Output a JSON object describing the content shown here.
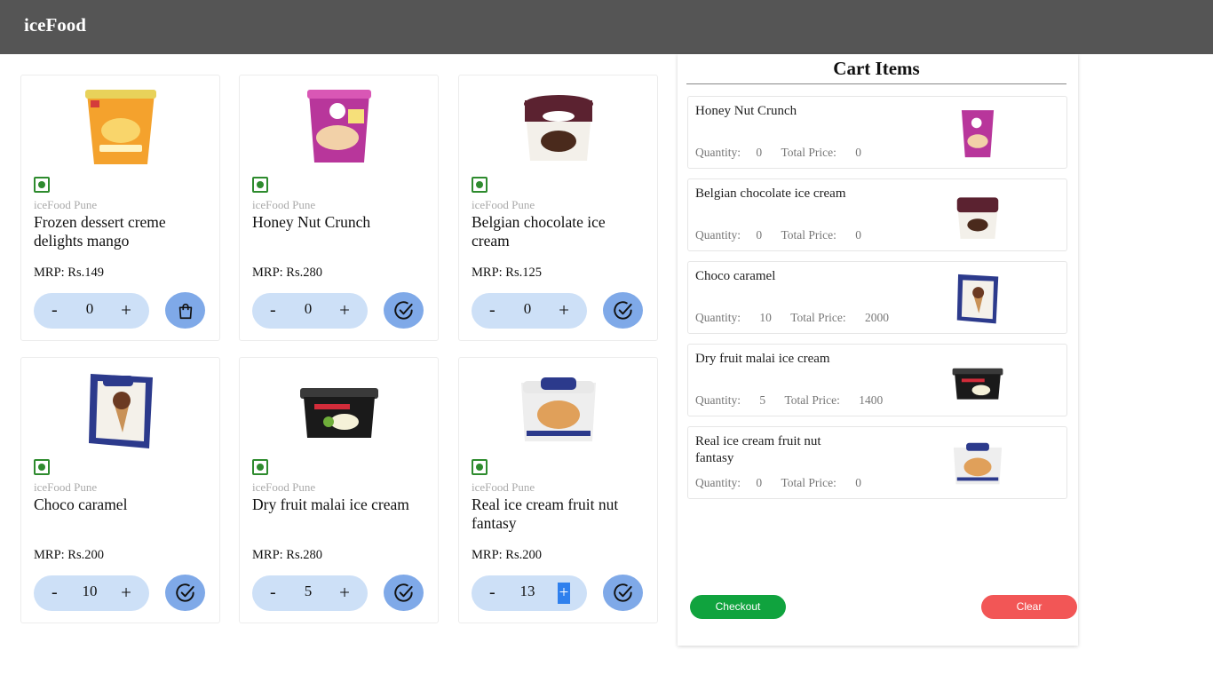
{
  "app": {
    "brand": "iceFood"
  },
  "products": [
    {
      "store": "iceFood Pune",
      "name": "Frozen dessert creme delights mango",
      "mrp": "MRP: Rs.149",
      "qty": "0",
      "action_icon": "bag-icon",
      "in_cart": false
    },
    {
      "store": "iceFood Pune",
      "name": "Honey Nut Crunch",
      "mrp": "MRP: Rs.280",
      "qty": "0",
      "action_icon": "check-circle-icon",
      "in_cart": true
    },
    {
      "store": "iceFood Pune",
      "name": "Belgian chocolate ice cream",
      "mrp": "MRP: Rs.125",
      "qty": "0",
      "action_icon": "check-circle-icon",
      "in_cart": true
    },
    {
      "store": "iceFood Pune",
      "name": "Choco caramel",
      "mrp": "MRP: Rs.200",
      "qty": "10",
      "action_icon": "check-circle-icon",
      "in_cart": true
    },
    {
      "store": "iceFood Pune",
      "name": "Dry fruit malai ice cream",
      "mrp": "MRP: Rs.280",
      "qty": "5",
      "action_icon": "check-circle-icon",
      "in_cart": true
    },
    {
      "store": "iceFood Pune",
      "name": "Real ice cream fruit nut fantasy",
      "mrp": "MRP: Rs.200",
      "qty": "13",
      "action_icon": "check-circle-icon",
      "in_cart": true
    }
  ],
  "stepper": {
    "minus": "-",
    "plus": "+"
  },
  "cart": {
    "title": "Cart Items",
    "quantity_label": "Quantity:",
    "total_label": "Total Price:",
    "items": [
      {
        "name": "Honey Nut Crunch",
        "quantity": "0",
        "total": "0"
      },
      {
        "name": "Belgian chocolate ice cream",
        "quantity": "0",
        "total": "0"
      },
      {
        "name": "Choco caramel",
        "quantity": "10",
        "total": "2000"
      },
      {
        "name": "Dry fruit malai ice cream",
        "quantity": "5",
        "total": "1400"
      },
      {
        "name": "Real ice cream fruit nut fantasy",
        "quantity": "0",
        "total": "0"
      }
    ],
    "checkout_label": "Checkout",
    "clear_label": "Clear"
  },
  "colors": {
    "navbar": "#555555",
    "stepper_bg": "#cde0f7",
    "action_button": "#7fa9e8",
    "checkout": "#10a33e",
    "clear": "#f25656",
    "veg_mark": "#2e8b2e"
  }
}
